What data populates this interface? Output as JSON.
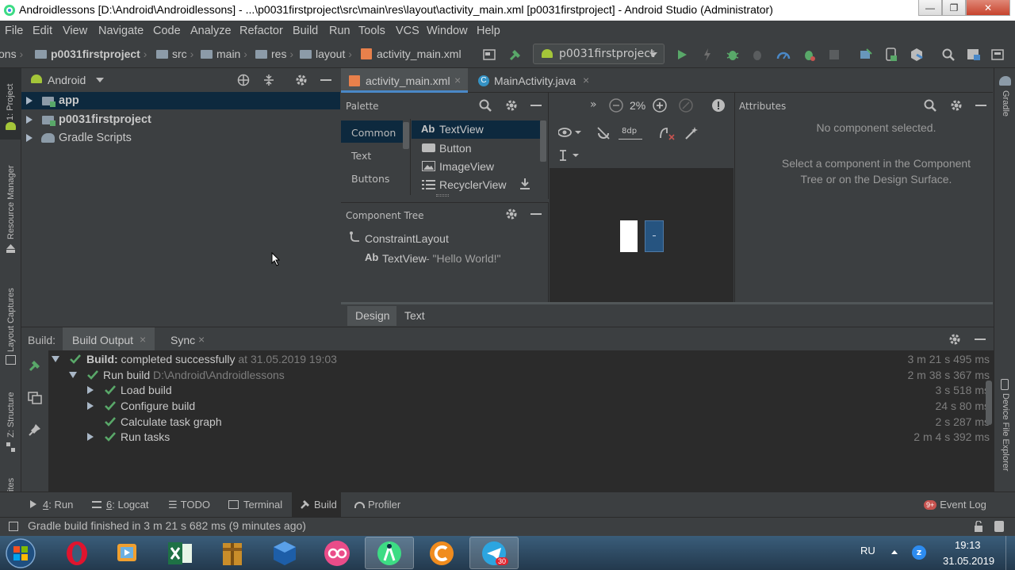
{
  "window": {
    "title": "Androidlessons [D:\\Android\\Androidlessons] - ...\\p0031firstproject\\src\\main\\res\\layout\\activity_main.xml [p0031firstproject] - Android Studio (Administrator)",
    "minimize": "—",
    "maximize": "❐",
    "close": "✕"
  },
  "menu": [
    "File",
    "Edit",
    "View",
    "Navigate",
    "Code",
    "Analyze",
    "Refactor",
    "Build",
    "Run",
    "Tools",
    "VCS",
    "Window",
    "Help"
  ],
  "breadcrumbs": [
    "ons",
    "p0031firstproject",
    "src",
    "main",
    "res",
    "layout",
    "activity_main.xml"
  ],
  "run_config": "p0031firstproject",
  "project": {
    "view_mode": "Android",
    "items": [
      {
        "label": "app"
      },
      {
        "label": "p0031firstproject"
      },
      {
        "label": "Gradle Scripts"
      }
    ]
  },
  "left_tools": [
    "1: Project",
    "Resource Manager",
    "Layout Captures",
    "Z: Structure",
    "ites"
  ],
  "right_tools": [
    "Gradle",
    "Device File Explorer"
  ],
  "editor_tabs": [
    {
      "label": "activity_main.xml"
    },
    {
      "label": "MainActivity.java"
    }
  ],
  "palette": {
    "title": "Palette",
    "categories": [
      "Common",
      "Text",
      "Buttons"
    ],
    "widgets": [
      "TextView",
      "Button",
      "ImageView",
      "RecyclerView"
    ],
    "textview_prefix": "Ab"
  },
  "component_tree": {
    "title": "Component Tree",
    "root": "ConstraintLayout",
    "child_prefix": "Ab",
    "child": "TextView",
    "child_suffix": "- \"Hello World!\""
  },
  "design_toolbar": {
    "zoom": "2%",
    "margin": "8dp"
  },
  "attributes": {
    "title": "Attributes",
    "empty_title": "No component selected.",
    "hint": "Select a component in the Component Tree or on the Design Surface."
  },
  "design_tabs": [
    "Design",
    "Text"
  ],
  "build": {
    "label": "Build:",
    "tabs": [
      "Build Output",
      "Sync"
    ],
    "rows": [
      {
        "bold": "Build:",
        "text": " completed successfully",
        "extra": " at 31.05.2019 19:03",
        "duration": "3 m 21 s 495 ms"
      },
      {
        "bold": "",
        "text": "Run build",
        "extra": " D:\\Android\\Androidlessons",
        "duration": "2 m 38 s 367 ms"
      },
      {
        "bold": "",
        "text": "Load build",
        "extra": "",
        "duration": "3 s 518 ms"
      },
      {
        "bold": "",
        "text": "Configure build",
        "extra": "",
        "duration": "24 s 80 ms"
      },
      {
        "bold": "",
        "text": "Calculate task graph",
        "extra": "",
        "duration": "2 s 287 ms"
      },
      {
        "bold": "",
        "text": "Run tasks",
        "extra": "",
        "duration": "2 m 4 s 392 ms"
      }
    ]
  },
  "bottom_tools": [
    {
      "num": "4",
      "label": ": Run"
    },
    {
      "num": "6",
      "label": ": Logcat"
    },
    {
      "num": "",
      "label": "TODO"
    },
    {
      "num": "",
      "label": "Terminal"
    },
    {
      "num": "",
      "label": "Build"
    },
    {
      "num": "",
      "label": "Profiler"
    }
  ],
  "event_log": {
    "badge": "9+",
    "label": "Event Log"
  },
  "status": "Gradle build finished in 3 m 21 s 682 ms (9 minutes ago)",
  "taskbar": {
    "lang": "RU",
    "time": "19:13",
    "date": "31.05.2019",
    "telegram_badge": "30"
  },
  "colors": {
    "ide_bg": "#3c3f41",
    "editor_bg": "#2b2b2b",
    "selection": "#0d293e",
    "check_green": "#59a869",
    "accent_blue": "#4a88c7"
  }
}
